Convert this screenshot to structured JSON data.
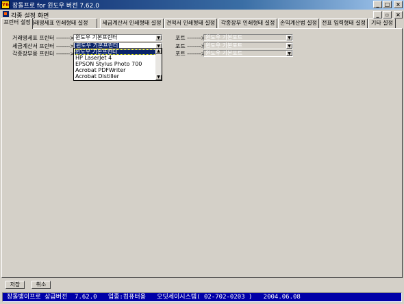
{
  "app": {
    "logo_text": "Y6",
    "title": "장돌프로 for 윈도우 버전  7.62.0"
  },
  "inner_window": {
    "title": "각종 설정 화면"
  },
  "tabs": [
    {
      "label": "프린터 설정",
      "active": true
    },
    {
      "label": "거래명세표 인쇄형태 설정",
      "active": false
    },
    {
      "label": "세금계산서 인쇄형태 설정",
      "active": false
    },
    {
      "label": "견적서 인쇄형태 설정",
      "active": false
    },
    {
      "label": "각종장부 인쇄형태 설정",
      "active": false
    },
    {
      "label": "손익계산법 설정",
      "active": false
    },
    {
      "label": "전표 입력형태 설정",
      "active": false
    },
    {
      "label": "기타 설정",
      "active": false
    }
  ],
  "printer_settings": {
    "rows": [
      {
        "label": "거래명세표 프린터 ------->",
        "printer": "윈도우 기본프린터",
        "port_label": "포트 ------->",
        "port": "윈도우 기본포트"
      },
      {
        "label": "세금계산서 프린터 ------->",
        "printer": "윈도우 기본프린터",
        "port_label": "포트 ------->",
        "port": "윈도우 기본포트"
      },
      {
        "label": "각종장부용 프린터 ------->",
        "printer": "",
        "port_label": "포트 ------->",
        "port": "윈도우 기본포트"
      }
    ],
    "dropdown_options": [
      "윈도우 기본프린터",
      "HP LaserJet 4",
      "EPSON Stylus Photo 700",
      "Acrobat PDFWriter",
      "Acrobat Distiller"
    ],
    "dropdown_selected_index": 0
  },
  "buttons": {
    "save": "저장",
    "cancel": "취소"
  },
  "status": {
    "text": "장돌뱅이프로 상급버전  7.62.0   업종:컴퓨터용   오딧세이시스템( 02-702-0203 )   2004.06.08"
  },
  "colors": {
    "title_bar": "#0a246a",
    "status_bar": "#0000a8",
    "face": "#d4d0c8"
  }
}
